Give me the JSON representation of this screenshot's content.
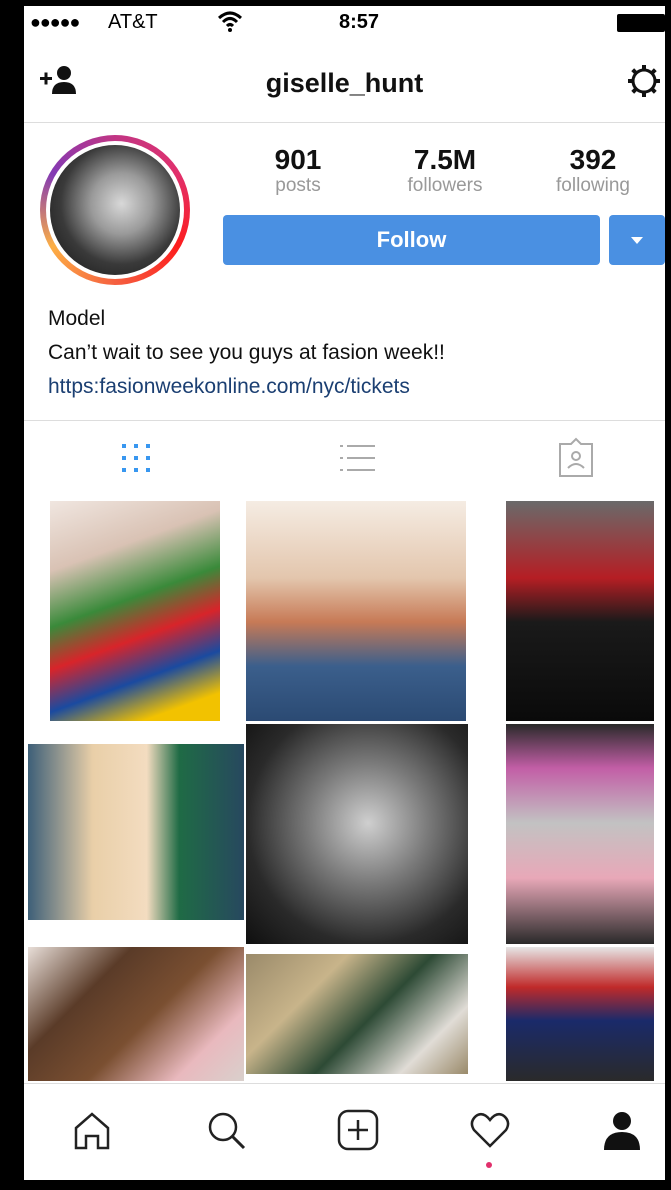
{
  "status_bar": {
    "signal": "●●●●●",
    "carrier": "AT&T",
    "time": "8:57"
  },
  "header": {
    "username": "giselle_hunt"
  },
  "profile": {
    "stats": [
      {
        "value": "901",
        "label": "posts"
      },
      {
        "value": "7.5M",
        "label": "followers"
      },
      {
        "value": "392",
        "label": "following"
      }
    ],
    "follow_label": "Follow",
    "bio_line1": "Model",
    "bio_line2": "Can’t wait to see you guys at fasion week!!",
    "bio_link": "https:fasionweekonline.com/nyc/tickets"
  },
  "tabs": [
    {
      "name": "grid-view",
      "icon": "grid-icon",
      "active": true
    },
    {
      "name": "list-view",
      "icon": "list-icon",
      "active": false
    },
    {
      "name": "tagged",
      "icon": "tagged-icon",
      "active": false
    }
  ],
  "colors": {
    "accent": "#4a90e2",
    "link": "#1b3f72",
    "notification": "#e1306c"
  },
  "bottom_nav": [
    {
      "icon": "home-icon"
    },
    {
      "icon": "search-icon"
    },
    {
      "icon": "add-post-icon"
    },
    {
      "icon": "activity-heart-icon"
    },
    {
      "icon": "profile-icon"
    }
  ]
}
